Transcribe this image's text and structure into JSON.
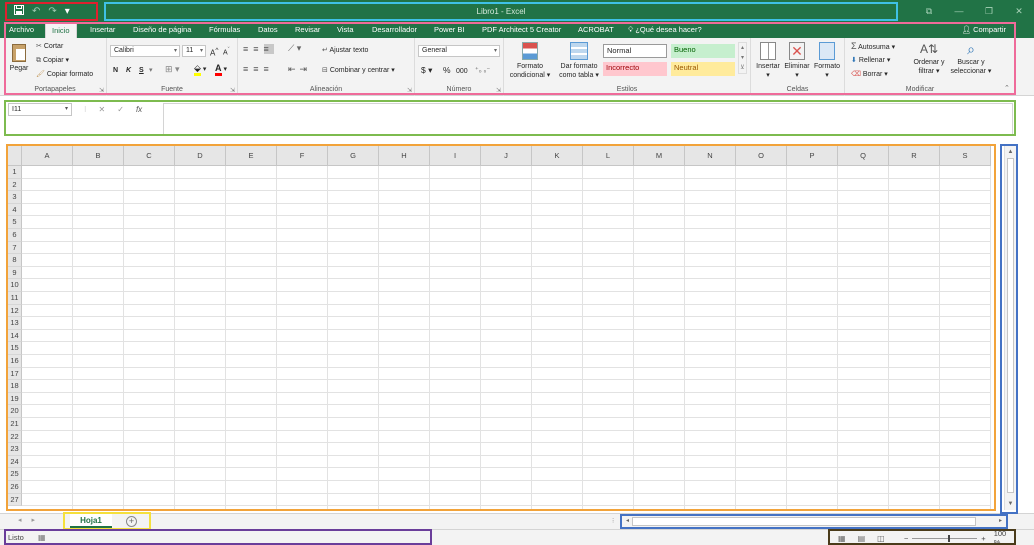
{
  "window": {
    "title": "Libro1 - Excel"
  },
  "qat": {
    "save": "save-icon",
    "undo": "↶",
    "redo": "↷",
    "customize": "▾"
  },
  "window_controls": {
    "restore": "⧉",
    "minimize": "—",
    "maximize": "❐",
    "close": "✕"
  },
  "tabs": [
    "Archivo",
    "Inicio",
    "Insertar",
    "Diseño de página",
    "Fórmulas",
    "Datos",
    "Revisar",
    "Vista",
    "Desarrollador",
    "Power BI",
    "PDF Architect 5 Creator",
    "ACROBAT"
  ],
  "tell_me": "¿Qué desea hacer?",
  "share": "Compartir",
  "ribbon": {
    "clipboard": {
      "label": "Portapapeles",
      "paste": "Pegar",
      "cut": "Cortar",
      "copy": "Copiar",
      "format_painter": "Copiar formato"
    },
    "font": {
      "label": "Fuente",
      "font_name": "Calibri",
      "font_size": "11",
      "bold": "N",
      "italic": "K",
      "underline": "S"
    },
    "alignment": {
      "label": "Alineación",
      "wrap": "Ajustar texto",
      "merge": "Combinar y centrar"
    },
    "number": {
      "label": "Número",
      "format": "General",
      "currency": "$",
      "percent": "%",
      "thousands": "000"
    },
    "styles": {
      "label": "Estilos",
      "conditional": "Formato condicional",
      "table": "Dar formato como tabla",
      "normal": "Normal",
      "bueno": "Bueno",
      "incorrecto": "Incorrecto",
      "neutral": "Neutral"
    },
    "cells": {
      "label": "Celdas",
      "insert": "Insertar",
      "delete": "Eliminar",
      "format": "Formato"
    },
    "editing": {
      "label": "Modificar",
      "autosum": "Autosuma",
      "fill": "Rellenar",
      "clear": "Borrar",
      "sort": "Ordenar y filtrar",
      "find": "Buscar y seleccionar"
    }
  },
  "formula_bar": {
    "name_box": "I11",
    "cancel": "✕",
    "enter": "✓",
    "fx": "fx",
    "value": ""
  },
  "grid": {
    "columns": [
      "A",
      "B",
      "C",
      "D",
      "E",
      "F",
      "G",
      "H",
      "I",
      "J",
      "K",
      "L",
      "M",
      "N",
      "O",
      "P",
      "Q",
      "R",
      "S"
    ],
    "rows": [
      "1",
      "2",
      "3",
      "4",
      "5",
      "6",
      "7",
      "8",
      "9",
      "10",
      "11",
      "12",
      "13",
      "14",
      "15",
      "16",
      "17",
      "18",
      "19",
      "20",
      "21",
      "22",
      "23",
      "24",
      "25",
      "26",
      "27"
    ]
  },
  "sheets": {
    "active": "Hoja1",
    "add": "+"
  },
  "status": {
    "text": "Listo",
    "zoom": "100 %",
    "zoom_minus": "−",
    "zoom_plus": "+"
  },
  "colors": {
    "accent": "#217346",
    "ribbon_bg": "#f3f3f3",
    "header_bg": "#e6e6e6",
    "bueno_bg": "#c6efce",
    "bueno_fg": "#006100",
    "incorrecto_bg": "#ffc7ce",
    "incorrecto_fg": "#9c0006",
    "neutral_bg": "#ffeb9c",
    "neutral_fg": "#9c5700"
  }
}
